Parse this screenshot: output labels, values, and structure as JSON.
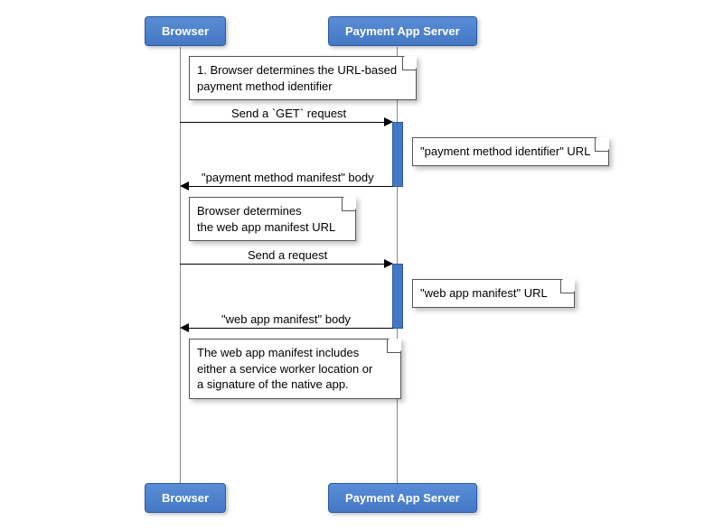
{
  "participants": {
    "left": "Browser",
    "right": "Payment App Server"
  },
  "notes": {
    "n1_line1": "1. Browser determines the URL-based",
    "n1_line2": "payment method identifier",
    "n2": "\"payment method identifier\" URL",
    "n3_line1": "Browser determines",
    "n3_line2": "the web app manifest URL",
    "n4": "\"web app manifest\" URL",
    "n5_line1": "The web app manifest includes",
    "n5_line2": "either a service worker location or",
    "n5_line3": "a signature of the native app."
  },
  "messages": {
    "m1": "Send a `GET` request",
    "m2": "\"payment method manifest\" body",
    "m3": "Send a request",
    "m4": "\"web app manifest\" body"
  }
}
